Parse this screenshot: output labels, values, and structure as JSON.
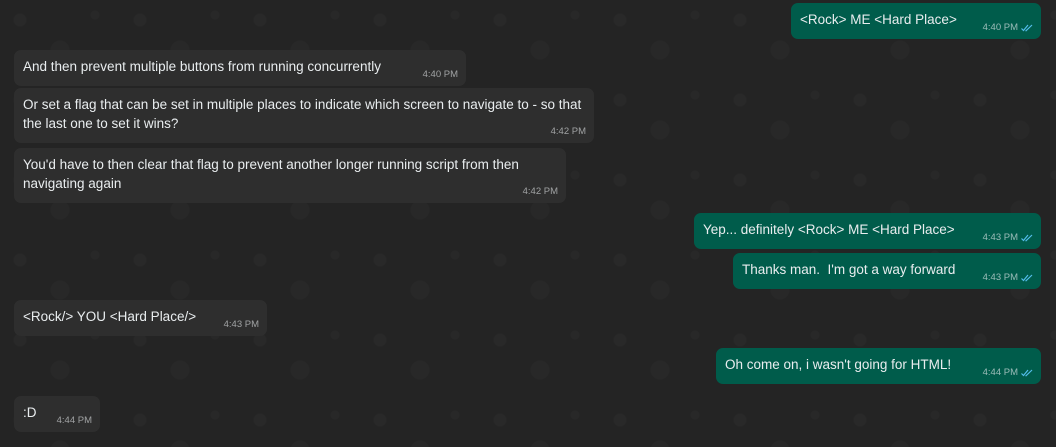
{
  "colors": {
    "background": "#242424",
    "incoming": "#2e2e2e",
    "outgoing": "#005c4b",
    "read_tick": "#53bdeb"
  },
  "messages": [
    {
      "dir": "out",
      "text": "<Rock> ME <Hard Place>",
      "time": "4:40 PM"
    },
    {
      "dir": "in",
      "text": "And then prevent multiple buttons from running concurrently",
      "time": "4:40 PM"
    },
    {
      "dir": "in",
      "text": "Or set a flag that can be set in multiple places to indicate which screen to navigate to - so that the last one to set it wins?",
      "time": "4:42 PM"
    },
    {
      "dir": "in",
      "text": "You'd have to then clear that flag to prevent another longer running script from then navigating again",
      "time": "4:42 PM"
    },
    {
      "dir": "out",
      "text": "Yep... definitely <Rock> ME <Hard Place>",
      "time": "4:43 PM"
    },
    {
      "dir": "out",
      "text": "Thanks man.  I'm got a way forward",
      "time": "4:43 PM"
    },
    {
      "dir": "in",
      "text": "<Rock/> YOU <Hard Place/>",
      "time": "4:43 PM"
    },
    {
      "dir": "out",
      "text": "Oh come on, i wasn't going for HTML!",
      "time": "4:44 PM"
    },
    {
      "dir": "in",
      "text": ":D",
      "time": "4:44 PM"
    }
  ]
}
